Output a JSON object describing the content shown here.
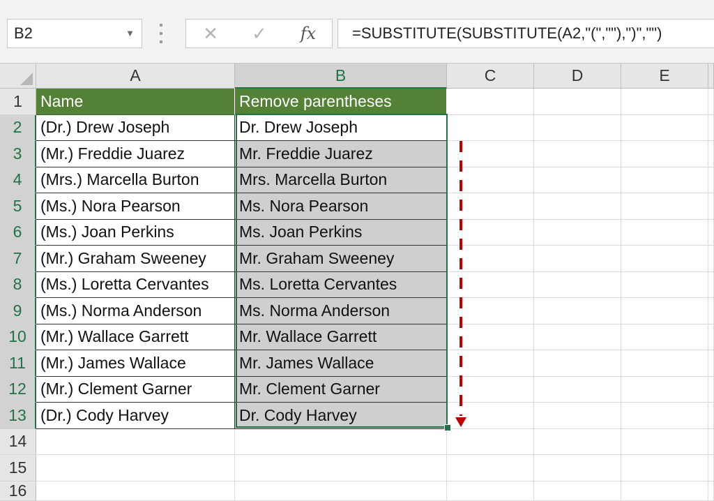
{
  "name_box": {
    "value": "B2"
  },
  "formula_bar": {
    "cancel_glyph": "✕",
    "enter_glyph": "✓",
    "fx_label": "fx",
    "formula": "=SUBSTITUTE(SUBSTITUTE(A2,\"(\",\"\"),\")\",\"\")"
  },
  "columns": [
    "A",
    "B",
    "C",
    "D",
    "E"
  ],
  "rows": [
    "1",
    "2",
    "3",
    "4",
    "5",
    "6",
    "7",
    "8",
    "9",
    "10",
    "11",
    "12",
    "13",
    "14",
    "15",
    "16"
  ],
  "table": {
    "header": {
      "name": "Name",
      "remove": "Remove parentheses"
    },
    "data": [
      {
        "name": "(Dr.) Drew Joseph",
        "result": "Dr. Drew Joseph"
      },
      {
        "name": "(Mr.) Freddie Juarez",
        "result": "Mr. Freddie Juarez"
      },
      {
        "name": "(Mrs.) Marcella Burton",
        "result": "Mrs. Marcella Burton"
      },
      {
        "name": "(Ms.) Nora Pearson",
        "result": "Ms. Nora Pearson"
      },
      {
        "name": "(Ms.) Joan Perkins",
        "result": "Ms. Joan Perkins"
      },
      {
        "name": "(Mr.) Graham Sweeney",
        "result": "Mr. Graham Sweeney"
      },
      {
        "name": "(Ms.) Loretta Cervantes",
        "result": "Ms. Loretta Cervantes"
      },
      {
        "name": "(Ms.) Norma Anderson",
        "result": "Ms. Norma Anderson"
      },
      {
        "name": "(Mr.) Wallace Garrett",
        "result": "Mr. Wallace Garrett"
      },
      {
        "name": "(Mr.) James Wallace",
        "result": "Mr. James Wallace"
      },
      {
        "name": "(Mr.) Clement Garner",
        "result": "Mr. Clement Garner"
      },
      {
        "name": "(Dr.) Cody Harvey",
        "result": "Dr. Cody Harvey"
      }
    ]
  },
  "colors": {
    "header_fill": "#538135",
    "selection": "#217346",
    "arrow": "#c00000"
  }
}
